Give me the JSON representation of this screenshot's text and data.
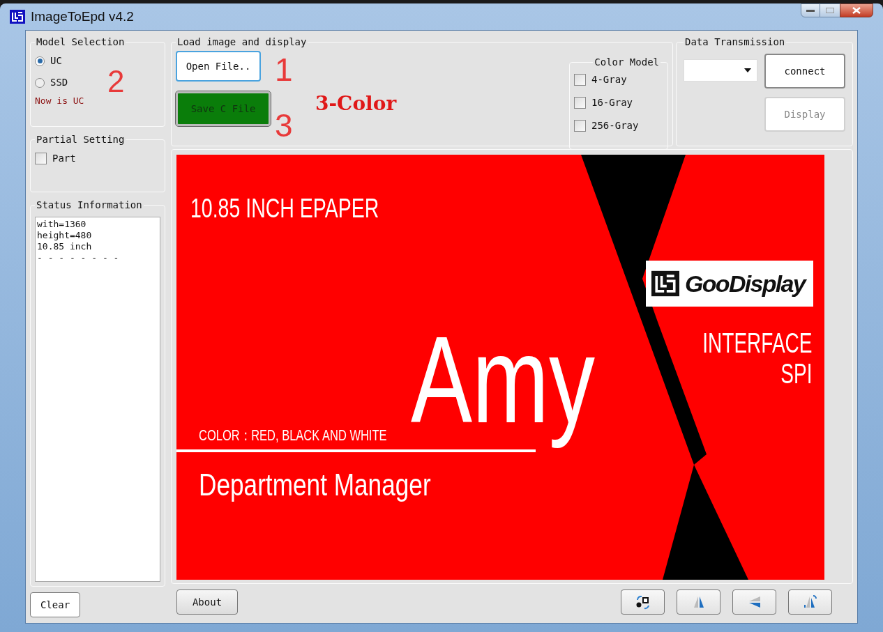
{
  "window": {
    "title": "ImageToEpd v4.2"
  },
  "model_selection": {
    "title": "Model Selection",
    "options": [
      {
        "label": "UC",
        "selected": true
      },
      {
        "label": "SSD",
        "selected": false
      }
    ],
    "status": "Now is UC"
  },
  "partial_setting": {
    "title": "Partial Setting",
    "options": [
      {
        "label": "Part",
        "checked": false
      }
    ]
  },
  "status_information": {
    "title": "Status Information",
    "lines": [
      "with=1360",
      "height=480",
      "10.85 inch",
      "- - - - - - - -"
    ]
  },
  "clear_button": "Clear",
  "load_image": {
    "title": "Load image and display",
    "open_button": "Open File..",
    "save_button": "Save C File"
  },
  "annotations": [
    {
      "text": "2"
    },
    {
      "text": "1"
    },
    {
      "text": "3"
    },
    {
      "text": "3-Color"
    }
  ],
  "color_model": {
    "title": "Color Model",
    "options": [
      {
        "label": "4-Gray",
        "checked": false
      },
      {
        "label": "16-Gray",
        "checked": false
      },
      {
        "label": "256-Gray",
        "checked": false
      }
    ]
  },
  "data_transmission": {
    "title": "Data Transmission",
    "connect_button": "connect",
    "display_button": {
      "label": "Display",
      "disabled": true
    }
  },
  "preview": {
    "heading": "10.85 INCH EPAPER",
    "logo": "GooDisplay",
    "name": "Amy",
    "color_line": "COLOR：RED, BLACK AND WHITE",
    "role": "Department Manager",
    "interface": "INTERFACE",
    "bus": "SPI"
  },
  "about_button": "About",
  "toolbar": [
    {
      "kind": "swap"
    },
    {
      "kind": "mirror-h"
    },
    {
      "kind": "mirror-v"
    },
    {
      "kind": "rotate"
    }
  ]
}
